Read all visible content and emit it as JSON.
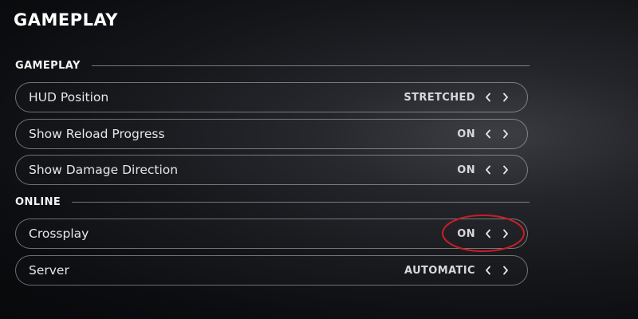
{
  "page": {
    "title": "GAMEPLAY"
  },
  "sections": [
    {
      "header": "GAMEPLAY",
      "rows": [
        {
          "label": "HUD Position",
          "value": "STRETCHED"
        },
        {
          "label": "Show Reload Progress",
          "value": "ON"
        },
        {
          "label": "Show Damage Direction",
          "value": "ON"
        }
      ]
    },
    {
      "header": "ONLINE",
      "rows": [
        {
          "label": "Crossplay",
          "value": "ON"
        },
        {
          "label": "Server",
          "value": "AUTOMATIC"
        }
      ]
    }
  ],
  "icons": {
    "previous": "chevron-left-icon",
    "next": "chevron-right-icon"
  },
  "annotation": {
    "shape": "ellipse",
    "color": "#c81e28",
    "target": "Crossplay value and arrows"
  }
}
